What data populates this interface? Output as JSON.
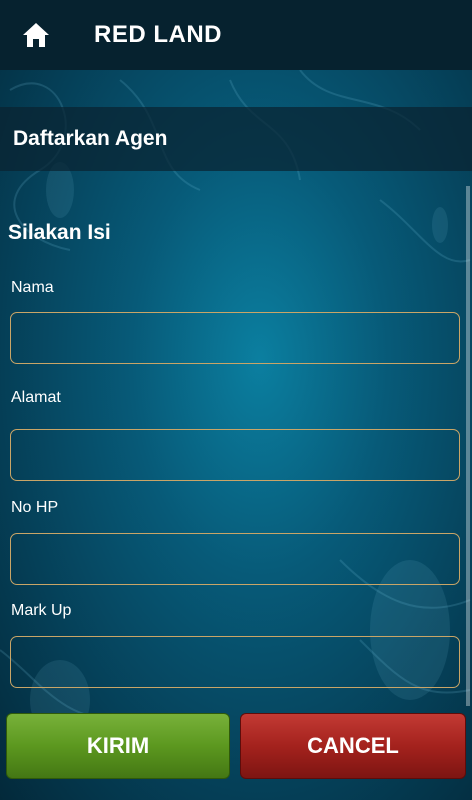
{
  "app_bar": {
    "title": "RED LAND",
    "home_icon": "home-icon"
  },
  "section": {
    "title": "Daftarkan Agen"
  },
  "form": {
    "title": "Silakan Isi",
    "fields": [
      {
        "label": "Nama",
        "value": ""
      },
      {
        "label": "Alamat",
        "value": ""
      },
      {
        "label": "No HP",
        "value": ""
      },
      {
        "label": "Mark Up",
        "value": ""
      }
    ]
  },
  "buttons": {
    "submit_label": "KIRIM",
    "cancel_label": "CANCEL"
  },
  "colors": {
    "app_bar_bg": "#06222f",
    "input_border": "#c9a567",
    "submit_green": "#5c981f",
    "cancel_red": "#a4221d"
  }
}
